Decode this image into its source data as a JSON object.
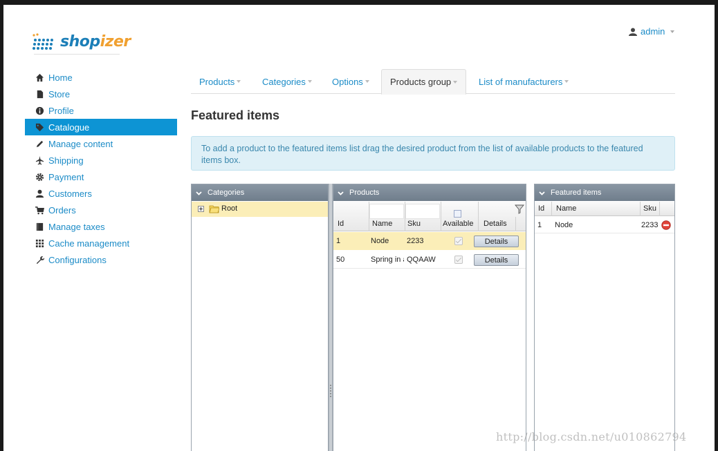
{
  "logo": {
    "part1": "shop",
    "part2": "izer"
  },
  "user": {
    "name": "admin"
  },
  "sidebar": {
    "items": [
      {
        "label": "Home",
        "icon": "home-icon"
      },
      {
        "label": "Store",
        "icon": "file-icon"
      },
      {
        "label": "Profile",
        "icon": "info-icon"
      },
      {
        "label": "Catalogue",
        "icon": "tag-icon",
        "active": true
      },
      {
        "label": "Manage content",
        "icon": "pencil-icon"
      },
      {
        "label": "Shipping",
        "icon": "plane-icon"
      },
      {
        "label": "Payment",
        "icon": "gear-icon"
      },
      {
        "label": "Customers",
        "icon": "user-icon"
      },
      {
        "label": "Orders",
        "icon": "cart-icon"
      },
      {
        "label": "Manage taxes",
        "icon": "book-icon"
      },
      {
        "label": "Cache management",
        "icon": "grid-icon"
      },
      {
        "label": "Configurations",
        "icon": "wrench-icon"
      }
    ]
  },
  "tabs": [
    {
      "label": "Products"
    },
    {
      "label": "Categories"
    },
    {
      "label": "Options"
    },
    {
      "label": "Products group",
      "active": true
    },
    {
      "label": "List of manufacturers"
    }
  ],
  "page": {
    "title": "Featured items",
    "info": "To add a product to the featured items list drag the desired product from the list of available products to the featured items box."
  },
  "categories_panel": {
    "title": "Categories",
    "tree": [
      {
        "label": "Root"
      }
    ]
  },
  "products_panel": {
    "title": "Products",
    "columns": {
      "id": "Id",
      "name": "Name",
      "sku": "Sku",
      "available": "Available",
      "details": "Details"
    },
    "rows": [
      {
        "id": "1",
        "name": "Node",
        "sku": "2233",
        "details": "Details"
      },
      {
        "id": "50",
        "name": "Spring in action",
        "sku": "QQAAW",
        "details": "Details"
      }
    ]
  },
  "featured_panel": {
    "title": "Featured items",
    "columns": {
      "id": "Id",
      "name": "Name",
      "sku": "Sku"
    },
    "rows": [
      {
        "id": "1",
        "name": "Node",
        "sku": "2233"
      }
    ]
  },
  "watermark": "http://blog.csdn.net/u010862794",
  "colors": {
    "accent": "#0d94d4",
    "link": "#1b8bc7",
    "selected_row": "#fbeeb8",
    "info_bg": "#dff0f7"
  }
}
